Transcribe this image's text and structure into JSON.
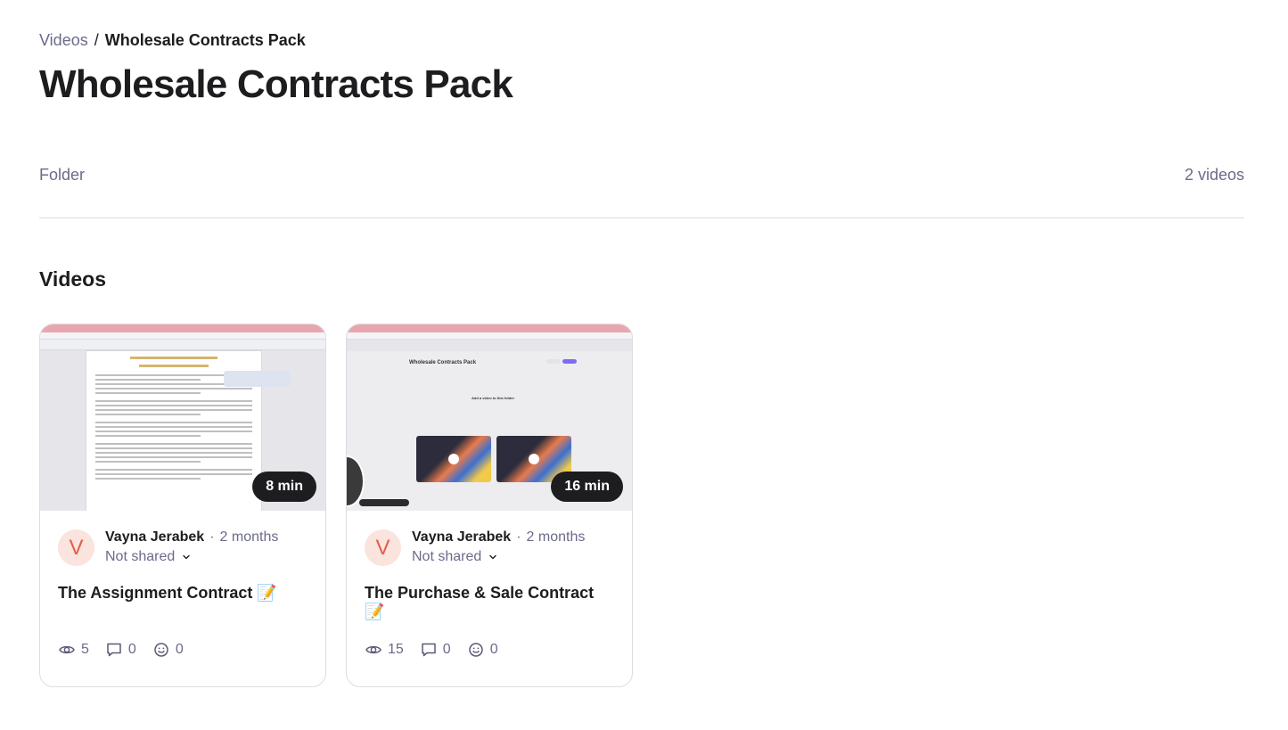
{
  "breadcrumb": {
    "parent": "Videos",
    "separator": "/",
    "current": "Wholesale Contracts Pack"
  },
  "page_title": "Wholesale Contracts Pack",
  "meta": {
    "type_label": "Folder",
    "count_label": "2 videos"
  },
  "section_title": "Videos",
  "videos": [
    {
      "duration": "8 min",
      "author_initial": "V",
      "author": "Vayna Jerabek",
      "dot": "·",
      "time_ago": "2 months",
      "sharing": "Not shared",
      "title": "The Assignment Contract 📝",
      "views": "5",
      "comments": "0",
      "reactions": "0"
    },
    {
      "duration": "16 min",
      "author_initial": "V",
      "author": "Vayna Jerabek",
      "dot": "·",
      "time_ago": "2 months",
      "sharing": "Not shared",
      "title": "The Purchase & Sale Contract 📝",
      "views": "15",
      "comments": "0",
      "reactions": "0"
    }
  ],
  "thumbnail_mini": {
    "folder_title": "Wholesale Contracts Pack",
    "add_prompt": "Add a video to this folder"
  },
  "icons": {
    "views": "eye-icon",
    "comments": "comment-icon",
    "reactions": "smiley-icon",
    "sharing": "chevron-down-icon"
  },
  "colors": {
    "accent_avatar_bg": "#fbe3de",
    "accent_avatar_fg": "#e0604a",
    "muted_text": "#6b6b8a",
    "duration_badge": "#1d1d1f"
  }
}
